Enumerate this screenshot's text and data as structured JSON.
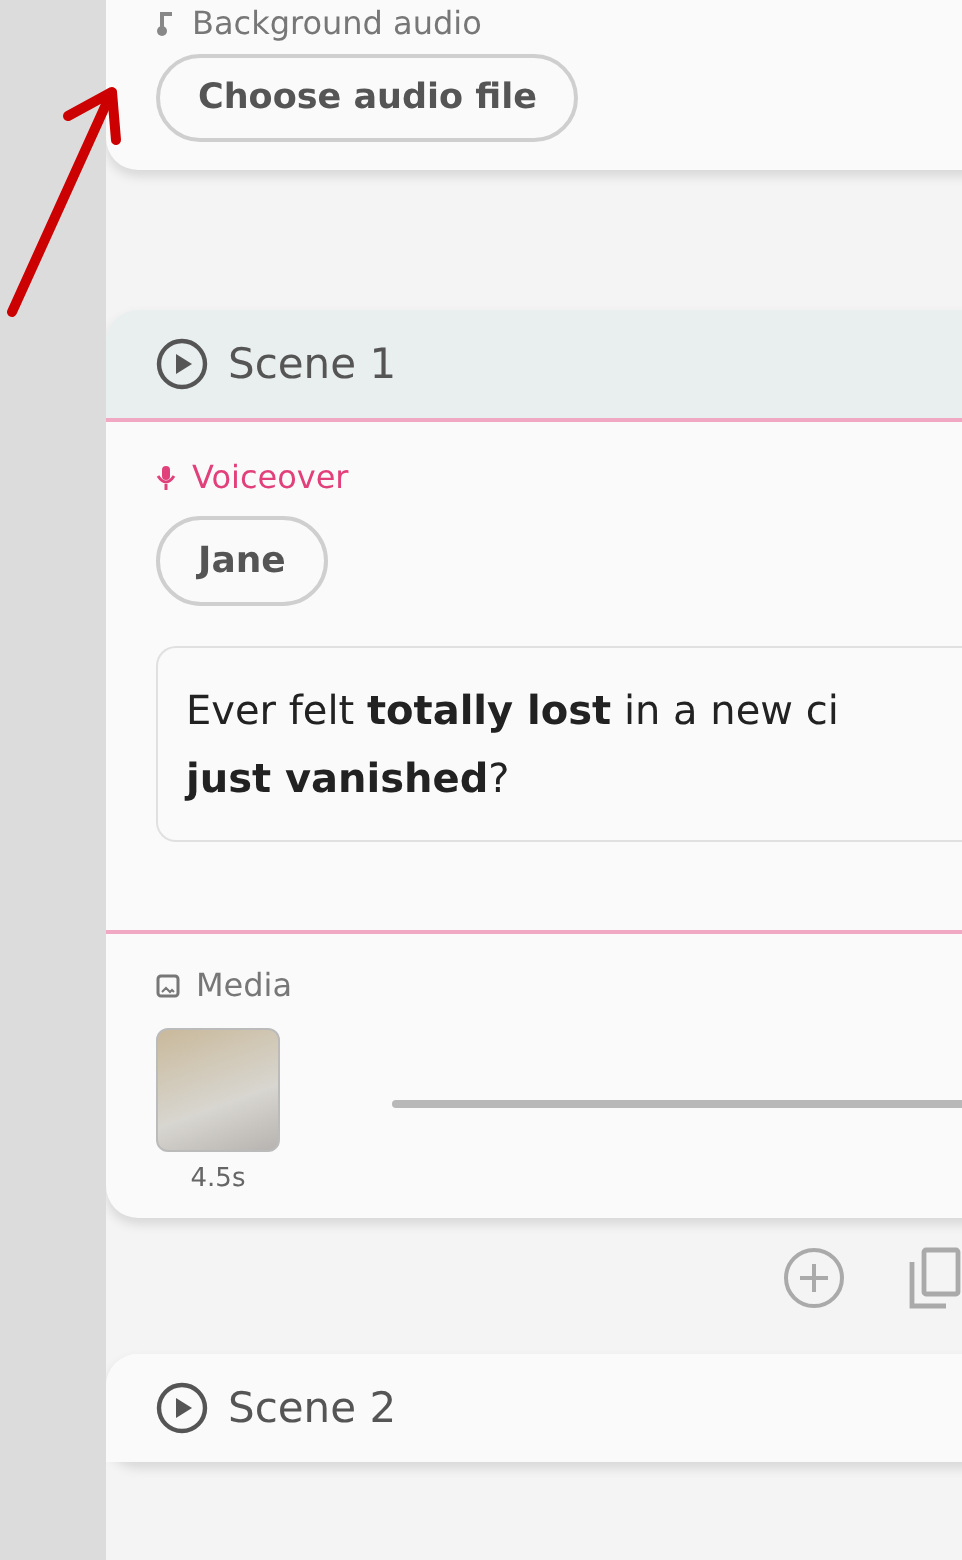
{
  "background_audio": {
    "label": "Background audio",
    "button": "Choose audio file"
  },
  "scenes": [
    {
      "title": "Scene 1",
      "voiceover": {
        "label": "Voiceover",
        "voice": "Jane",
        "script_lines": [
          "Ever felt **totally lost** in a new ci",
          "**just vanished**?"
        ]
      },
      "media": {
        "label": "Media",
        "clips": [
          {
            "duration": "4.5s"
          }
        ]
      }
    },
    {
      "title": "Scene 2"
    }
  ]
}
